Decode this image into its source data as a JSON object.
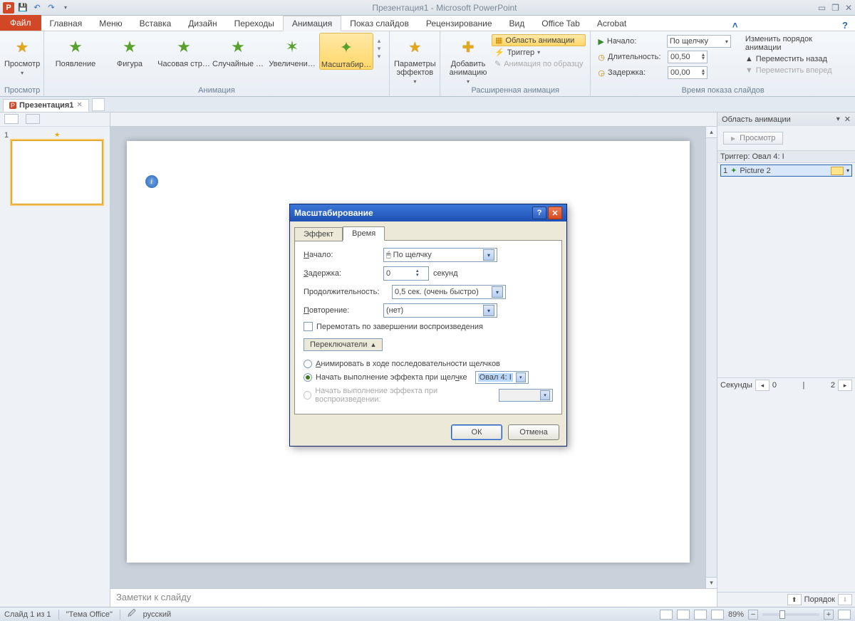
{
  "title": "Презентация1  -  Microsoft PowerPoint",
  "ribbon_tabs": {
    "file": "Файл",
    "items": [
      "Главная",
      "Меню",
      "Вставка",
      "Дизайн",
      "Переходы",
      "Анимация",
      "Показ слайдов",
      "Рецензирование",
      "Вид",
      "Office Tab",
      "Acrobat"
    ],
    "active": "Анимация"
  },
  "ribbon": {
    "preview": {
      "label": "Просмотр",
      "group": "Просмотр"
    },
    "gallery": {
      "items": [
        "Появление",
        "Фигура",
        "Часовая стр…",
        "Случайные …",
        "Увеличени…",
        "Масштабир…"
      ],
      "group": "Анимация"
    },
    "effect_options": "Параметры\nэффектов",
    "advanced": {
      "add": "Добавить\nанимацию",
      "pane": "Область анимации",
      "trigger": "Триггер",
      "painter": "Анимация по образцу",
      "group": "Расширенная анимация"
    },
    "timing": {
      "start_label": "Начало:",
      "start_value": "По щелчку",
      "duration_label": "Длительность:",
      "duration_value": "00,50",
      "delay_label": "Задержка:",
      "delay_value": "00,00",
      "reorder": "Изменить порядок анимации",
      "move_back": "Переместить назад",
      "move_fwd": "Переместить вперед",
      "group": "Время показа слайдов"
    }
  },
  "doc_tab": "Презентация1",
  "slide_number": "1",
  "notes_placeholder": "Заметки к слайду",
  "anim_pane": {
    "title": "Область анимации",
    "preview": "Просмотр",
    "trigger": "Триггер: Овал 4: I",
    "item_index": "1",
    "item_name": "Picture 2",
    "seconds": "Секунды",
    "time_from": "0",
    "time_to": "2",
    "reorder": "Порядок"
  },
  "status": {
    "slide": "Слайд 1 из 1",
    "theme": "\"Тема Office\"",
    "language": "русский",
    "zoom": "89%"
  },
  "dialog": {
    "title": "Масштабирование",
    "tabs": {
      "effect": "Эффект",
      "timing": "Время"
    },
    "start_label": "Начало:",
    "start_value": "По щелчку",
    "delay_label": "Задержка:",
    "delay_value": "0",
    "delay_unit": "секунд",
    "duration_label": "Продолжительность:",
    "duration_value": "0,5 сек. (очень быстро)",
    "repeat_label": "Повторение:",
    "repeat_value": "(нет)",
    "rewind": "Перемотать по завершении воспроизведения",
    "triggers_toggle": "Переключатели",
    "radio_seq": "Анимировать в ходе последовательности щелчков",
    "radio_click": "Начать выполнение эффекта при щелчке",
    "radio_click_value": "Овал 4: I",
    "radio_play": "Начать выполнение эффекта при воспроизведении:",
    "ok": "ОК",
    "cancel": "Отмена"
  }
}
